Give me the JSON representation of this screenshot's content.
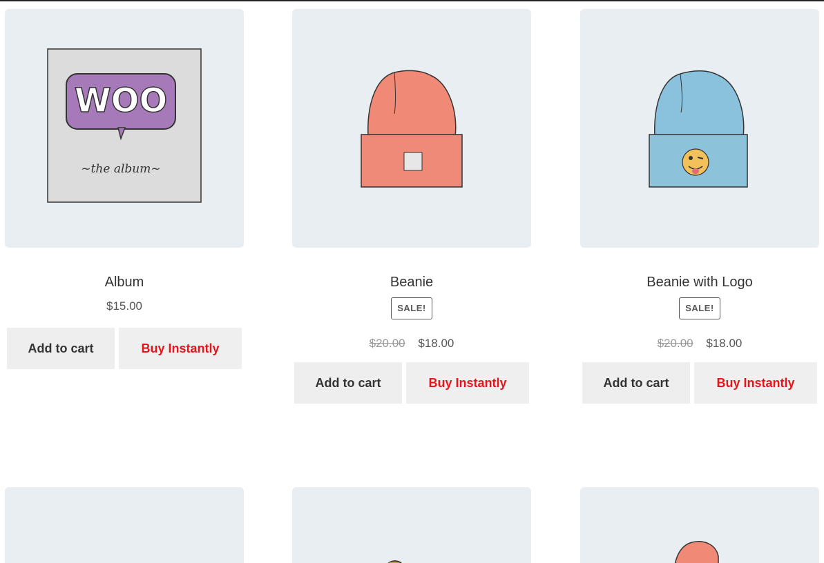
{
  "products": [
    {
      "title": "Album",
      "price": "$15.00",
      "add_label": "Add to cart",
      "buy_label": "Buy Instantly"
    },
    {
      "title": "Beanie",
      "sale_badge": "SALE!",
      "old_price": "$20.00",
      "price": "$18.00",
      "add_label": "Add to cart",
      "buy_label": "Buy Instantly"
    },
    {
      "title": "Beanie with Logo",
      "sale_badge": "SALE!",
      "old_price": "$20.00",
      "price": "$18.00",
      "add_label": "Add to cart",
      "buy_label": "Buy Instantly"
    }
  ],
  "album_art": {
    "logo_text": "WOO",
    "caption": "~the album~"
  }
}
